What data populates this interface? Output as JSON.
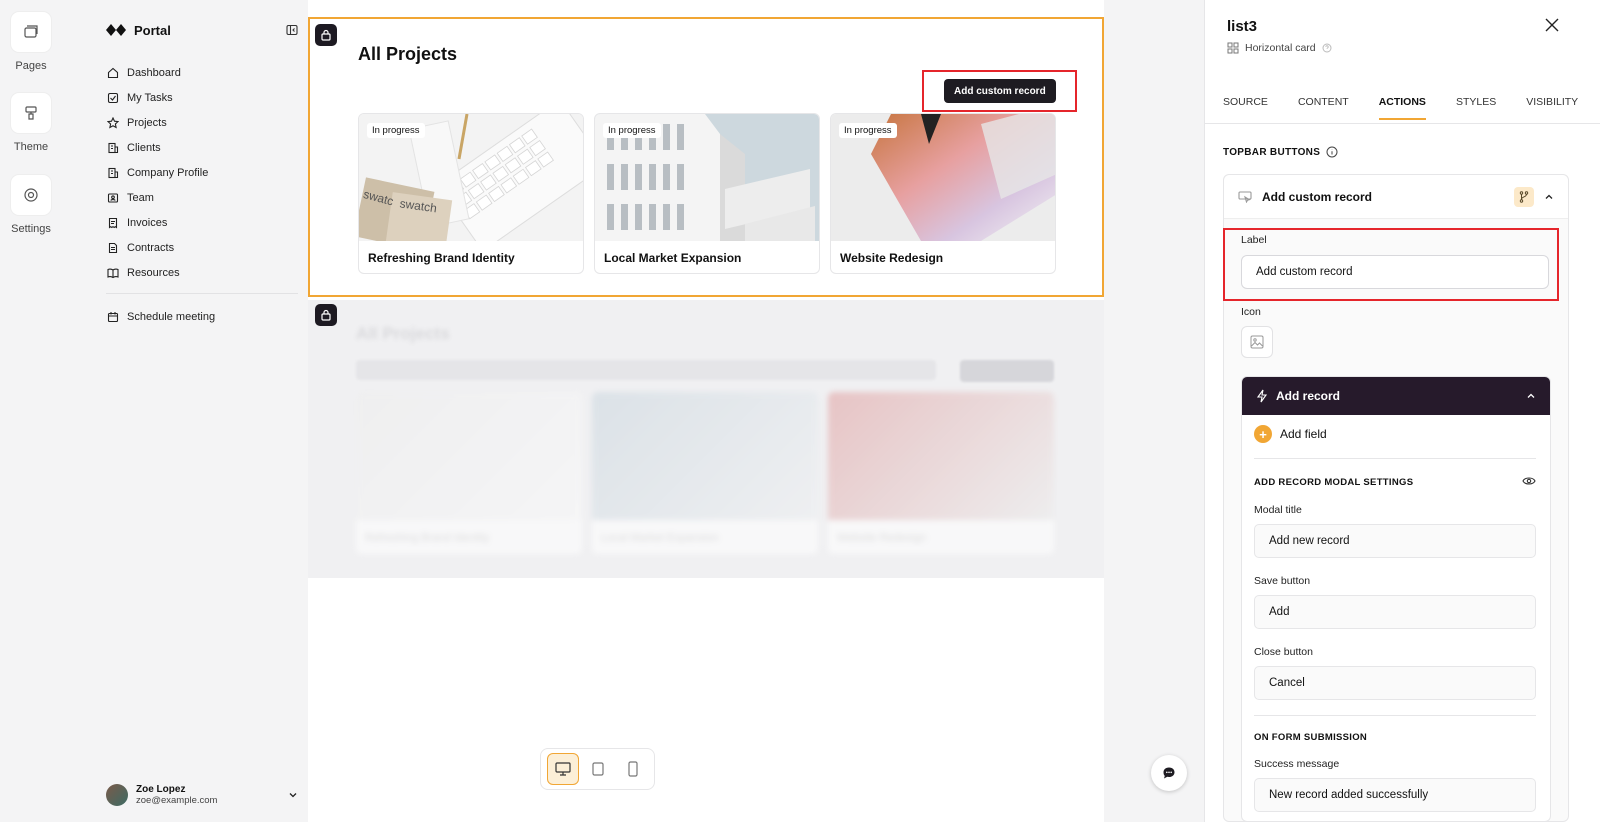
{
  "rail": {
    "items": [
      {
        "label": "Pages",
        "icon": "pages-icon"
      },
      {
        "label": "Theme",
        "icon": "paint-roller-icon"
      },
      {
        "label": "Settings",
        "icon": "gear-icon"
      }
    ]
  },
  "nav": {
    "brand": "Portal",
    "items": [
      {
        "label": "Dashboard",
        "icon": "home-icon"
      },
      {
        "label": "My Tasks",
        "icon": "checkbox-icon"
      },
      {
        "label": "Projects",
        "icon": "star-icon"
      },
      {
        "label": "Clients",
        "icon": "building-icon"
      },
      {
        "label": "Company Profile",
        "icon": "building-icon"
      },
      {
        "label": "Team",
        "icon": "contact-card-icon"
      },
      {
        "label": "Invoices",
        "icon": "receipt-icon"
      },
      {
        "label": "Contracts",
        "icon": "document-icon"
      },
      {
        "label": "Resources",
        "icon": "book-icon"
      }
    ],
    "secondary": {
      "label": "Schedule meeting",
      "icon": "calendar-icon"
    },
    "user": {
      "name": "Zoe Lopez",
      "email": "zoe@example.com"
    }
  },
  "canvas": {
    "block_title": "All Projects",
    "add_button": "Add custom record",
    "cards": [
      {
        "title": "Refreshing Brand Identity",
        "badge": "In progress"
      },
      {
        "title": "Local Market Expansion",
        "badge": "In progress"
      },
      {
        "title": "Website Redesign",
        "badge": "In progress"
      }
    ]
  },
  "panel": {
    "title": "list3",
    "subtitle": "Horizontal card",
    "tabs": [
      "SOURCE",
      "CONTENT",
      "ACTIONS",
      "STYLES",
      "VISIBILITY"
    ],
    "active_tab": "ACTIONS",
    "section": "TOPBAR BUTTONS",
    "button": {
      "name": "Add custom record",
      "label_label": "Label",
      "label_value": "Add custom record",
      "icon_label": "Icon"
    },
    "action": {
      "title": "Add record",
      "add_field": "Add field",
      "modal_section": "ADD RECORD MODAL SETTINGS",
      "modal_title_label": "Modal title",
      "modal_title_value": "Add new record",
      "save_label": "Save button",
      "save_value": "Add",
      "close_label": "Close button",
      "close_value": "Cancel",
      "submission_section": "ON FORM SUBMISSION",
      "success_label": "Success message",
      "success_value": "New record added successfully"
    }
  },
  "colors": {
    "accent": "#f1a634",
    "dark": "#1e1c22",
    "highlight": "#e5252b",
    "action_header": "#261a2b"
  }
}
